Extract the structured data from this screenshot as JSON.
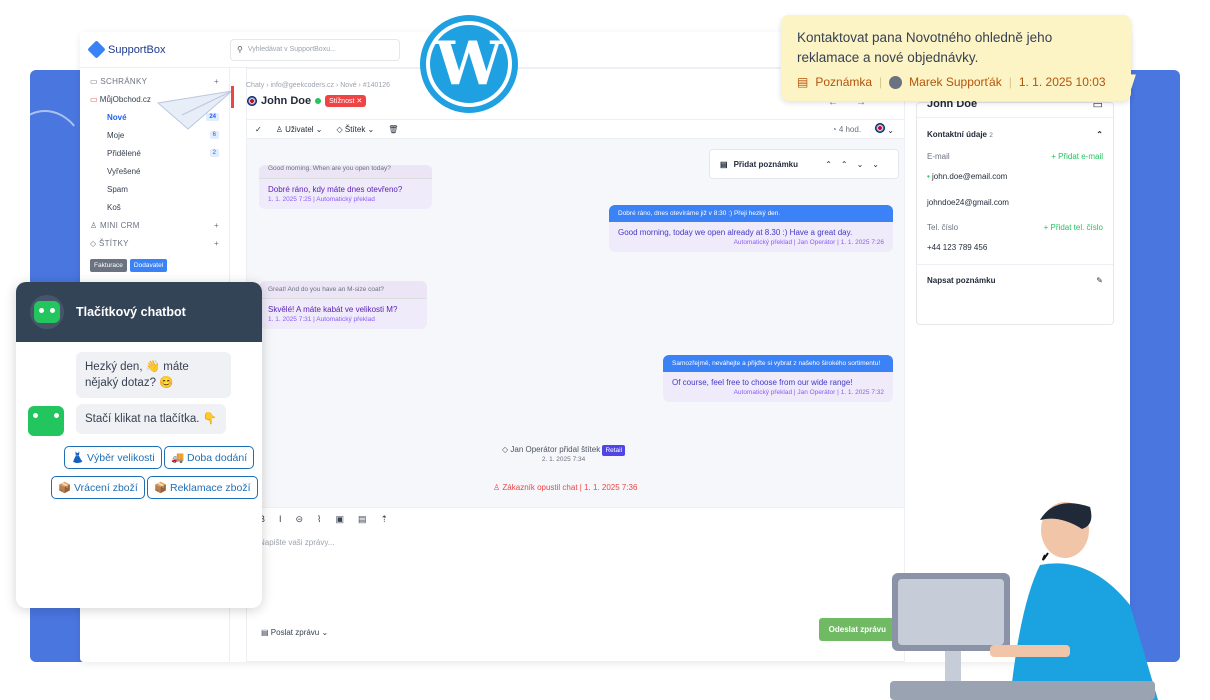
{
  "app": {
    "logo": "SupportBox",
    "search_placeholder": "Vyhledávat v SupportBoxu..."
  },
  "sidebar": {
    "sections": {
      "inboxes": "SCHRÁNKY",
      "crm": "MINI CRM",
      "tags": "ŠTÍTKY"
    },
    "shop": "MůjObchod.cz",
    "items": [
      {
        "label": "Nové",
        "count": "24"
      },
      {
        "label": "Moje",
        "count": "6"
      },
      {
        "label": "Přidělené",
        "count": "2"
      },
      {
        "label": "Vyřešené",
        "count": ""
      },
      {
        "label": "Spam",
        "count": ""
      },
      {
        "label": "Koš",
        "count": ""
      }
    ],
    "tags": [
      "Fakturace",
      "Dodavatel"
    ]
  },
  "chat": {
    "breadcrumb": "Chaty  ›  info@geekcoders.cz  ›  Nové  ›  #140126",
    "name": "John Doe",
    "badge": "Stížnost ✕",
    "toolbar": {
      "user": "Uživatel",
      "tag": "Štítek",
      "time": "4 hod."
    },
    "add_note": "Přidat poznámku",
    "messages": [
      {
        "quote": "Good morning. When are you open today?",
        "text": "Dobré ráno, kdy máte dnes otevřeno?",
        "meta": "1. 1. 2025 7:25  |  Automatický překlad"
      },
      {
        "quote": "Dobré ráno, dnes otevíráme již v 8:30 :) Přeji hezký den.",
        "text": "Good morning, today we open already at 8.30 :) Have a great day.",
        "meta": "Automatický překlad  |  Jan Operátor  |  1. 1. 2025 7:26"
      },
      {
        "quote": "Great! And do you have an M-size coat?",
        "text": "Skvělé! A máte kabát ve velikosti M?",
        "meta": "1. 1. 2025 7:31  |  Automatický překlad"
      },
      {
        "quote": "Samozřejmě, neváhejte a přijďte si vybrat z našeho širokého sortimentu!",
        "text": "Of course, feel free to choose from our wide range!",
        "meta": "Automatický překlad  |  Jan Operátor  |  1. 1. 2025 7:32"
      }
    ],
    "event_tag": "Jan Operátor přidal štítek",
    "event_tag_label": "Retail",
    "event_tag_time": "2. 1. 2025 7:34",
    "event_left": "Zákazník opustil chat  |  1. 1. 2025 7:36",
    "composer_placeholder": "Napište vaši zprávy...",
    "send_mode": "Poslat zprávu",
    "send_button": "Odeslat zprávu"
  },
  "contact": {
    "name": "John Doe",
    "section": "Kontaktní údaje",
    "count": "2",
    "email_label": "E-mail",
    "add_email": "+ Přidat e-mail",
    "emails": [
      "john.doe@email.com",
      "johndoe24@gmail.com"
    ],
    "phone_label": "Tel. číslo",
    "add_phone": "+ Přidat tel. číslo",
    "phone": "+44 123 789 456",
    "write_note": "Napsat poznámku"
  },
  "tooltip": {
    "text": "Kontaktovat pana Novotného ohledně jeho reklamace a nové objednávky.",
    "kind": "Poznámka",
    "author": "Marek Supporťák",
    "date": "1. 1. 2025 10:03"
  },
  "chatbot": {
    "title": "Tlačítkový chatbot",
    "msg1": "Hezký den, 👋 máte nějaký dotaz? 😊",
    "msg2": "Stačí klikat na tlačítka. 👇",
    "buttons": [
      "👗 Výběr velikosti",
      "🚚 Doba dodání",
      "📦 Vrácení zboží",
      "📦 Reklamace zboží"
    ]
  },
  "colors": {
    "accent": "#3b82f6",
    "band": "#4a76e0",
    "send": "#6fba63",
    "danger": "#ef4444",
    "note_bg": "#fdf4c6",
    "wordpress": "#1fa0e0"
  }
}
